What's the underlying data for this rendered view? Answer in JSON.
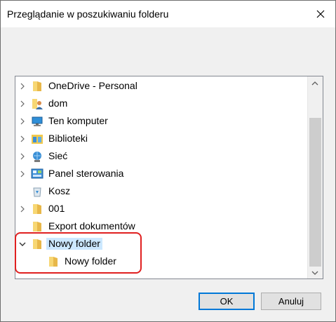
{
  "window": {
    "title": "Przeglądanie w poszukiwaniu folderu"
  },
  "tree": {
    "items": [
      {
        "label": "OneDrive - Personal",
        "icon": "folder-icon",
        "expander": "collapsed"
      },
      {
        "label": "dom",
        "icon": "user-folder-icon",
        "expander": "collapsed"
      },
      {
        "label": "Ten komputer",
        "icon": "computer-icon",
        "expander": "collapsed"
      },
      {
        "label": "Biblioteki",
        "icon": "libraries-icon",
        "expander": "collapsed"
      },
      {
        "label": "Sieć",
        "icon": "network-icon",
        "expander": "collapsed"
      },
      {
        "label": "Panel sterowania",
        "icon": "control-panel-icon",
        "expander": "collapsed"
      },
      {
        "label": "Kosz",
        "icon": "recycle-bin-icon",
        "expander": "none"
      },
      {
        "label": "001",
        "icon": "folder-icon",
        "expander": "collapsed"
      },
      {
        "label": "Export dokumentów",
        "icon": "folder-icon",
        "expander": "none"
      },
      {
        "label": "Nowy folder",
        "icon": "folder-icon",
        "expander": "expanded",
        "selected": true
      },
      {
        "label": "Nowy folder",
        "icon": "folder-icon",
        "expander": "none",
        "level": 2
      }
    ]
  },
  "buttons": {
    "ok": "OK",
    "cancel": "Anuluj"
  },
  "colors": {
    "selection": "#cce8ff",
    "highlight": "#e02020",
    "default_button_border": "#0078d7"
  }
}
